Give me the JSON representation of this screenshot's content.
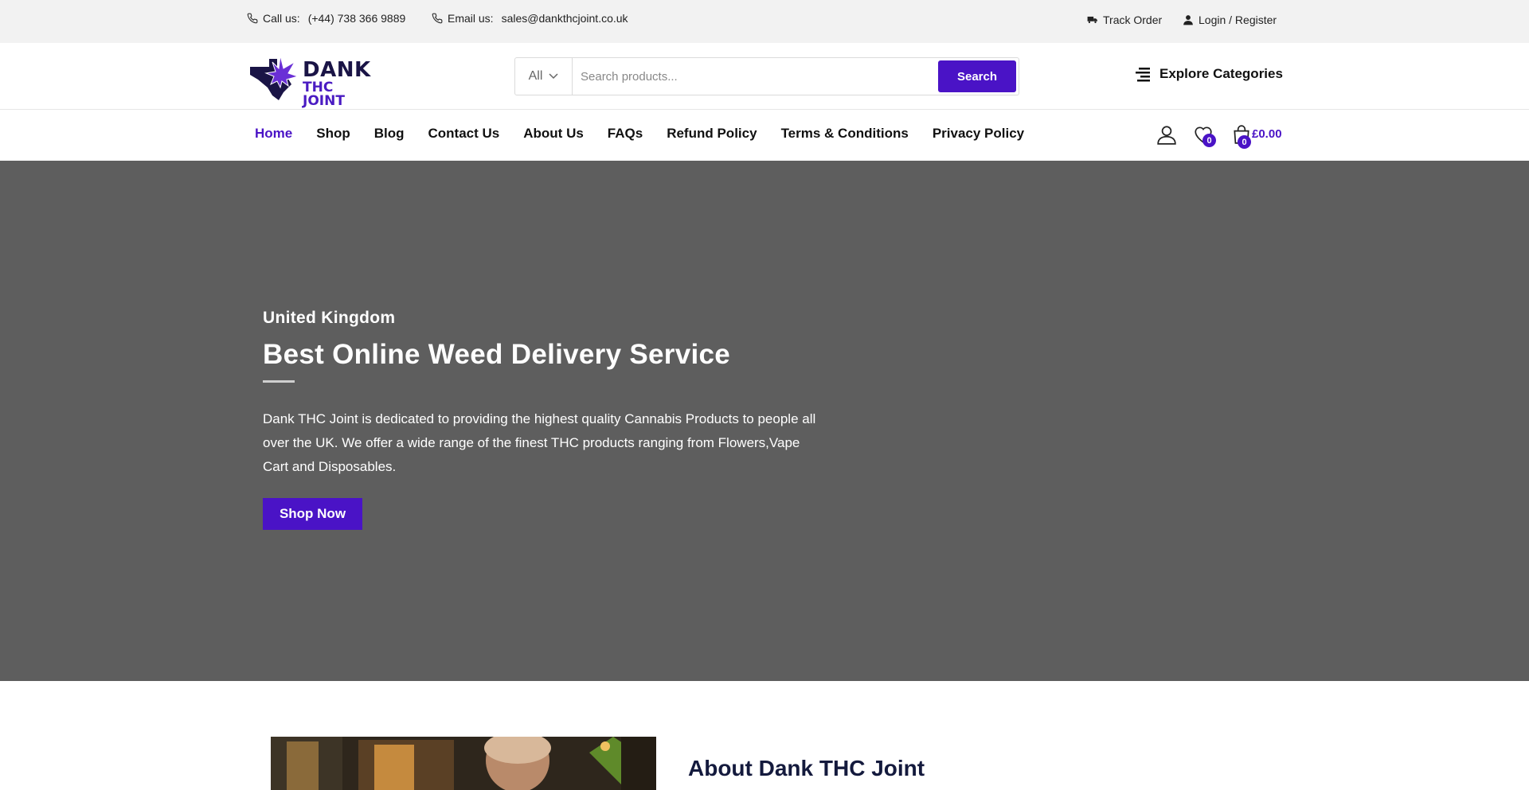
{
  "topbar": {
    "call_label": "Call us:",
    "call_value": "(+44) 738 366 9889",
    "email_label": "Email us:",
    "email_value": "sales@dankthcjoint.co.uk",
    "track_order": "Track Order",
    "login_register": "Login / Register"
  },
  "header": {
    "logo_line1": "DANK",
    "logo_line2": "THC JOINT",
    "search_category": "All",
    "search_placeholder": "Search products...",
    "search_button": "Search",
    "explore_categories": "Explore Categories"
  },
  "nav": {
    "links": [
      {
        "label": "Home",
        "active": true
      },
      {
        "label": "Shop"
      },
      {
        "label": "Blog"
      },
      {
        "label": "Contact Us"
      },
      {
        "label": "About Us"
      },
      {
        "label": "FAQs"
      },
      {
        "label": "Refund Policy"
      },
      {
        "label": "Terms & Conditions"
      },
      {
        "label": "Privacy Policy"
      }
    ],
    "wishlist_count": "0",
    "cart_count": "0",
    "cart_total": "£0.00"
  },
  "hero": {
    "subtitle": "United Kingdom",
    "title": "Best Online Weed Delivery Service",
    "description": "Dank THC Joint is dedicated to providing the highest quality Cannabis  Products to people all over the UK. We offer a wide range of the finest THC  products ranging from Flowers,Vape Cart and Disposables.",
    "button": "Shop Now"
  },
  "about": {
    "title": "About Dank THC Joint"
  },
  "colors": {
    "accent": "#4a13c6",
    "hero_bg": "#5e5e5e",
    "topbar_bg": "#f2f2f2",
    "heading_dark": "#141a3d"
  }
}
